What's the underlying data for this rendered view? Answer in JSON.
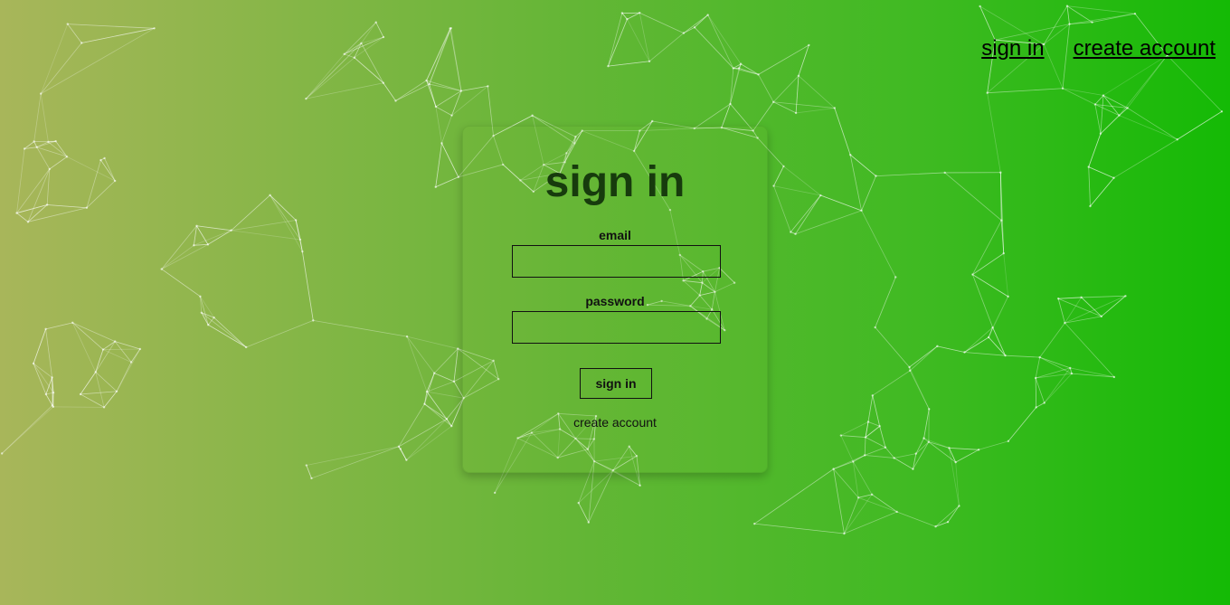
{
  "nav": {
    "sign_in": "sign in",
    "create_account": "create account"
  },
  "form": {
    "title": "sign in",
    "email_label": "email",
    "email_value": "",
    "password_label": "password",
    "password_value": "",
    "submit_label": "sign in",
    "create_account_link": "create account"
  },
  "colors": {
    "gradient_start": "#a8b65a",
    "gradient_end": "#14ba05",
    "title_color": "#173b0d",
    "line_color": "#ffffff"
  }
}
